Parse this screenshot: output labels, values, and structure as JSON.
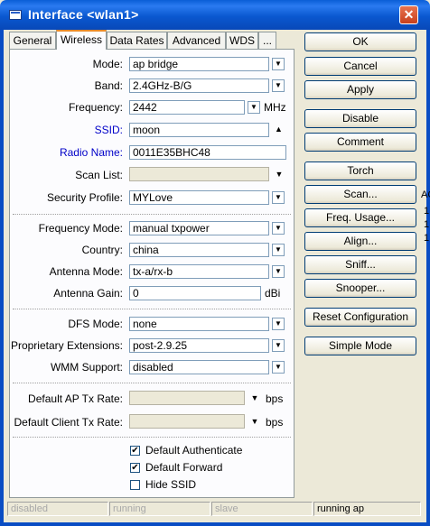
{
  "window": {
    "title": "Interface <wlan1>"
  },
  "tabs": [
    "General",
    "Wireless",
    "Data Rates",
    "Advanced",
    "WDS",
    "..."
  ],
  "form": {
    "mode": {
      "label": "Mode:",
      "value": "ap bridge"
    },
    "band": {
      "label": "Band:",
      "value": "2.4GHz-B/G"
    },
    "frequency": {
      "label": "Frequency:",
      "value": "2442",
      "unit": "MHz"
    },
    "ssid": {
      "label": "SSID:",
      "value": "moon"
    },
    "radio_name": {
      "label": "Radio Name:",
      "value": "0011E35BHC48"
    },
    "scan_list": {
      "label": "Scan List:",
      "value": ""
    },
    "security_profile": {
      "label": "Security Profile:",
      "value": "MYLove"
    },
    "frequency_mode": {
      "label": "Frequency Mode:",
      "value": "manual txpower"
    },
    "country": {
      "label": "Country:",
      "value": "china"
    },
    "antenna_mode": {
      "label": "Antenna Mode:",
      "value": "tx-a/rx-b"
    },
    "antenna_gain": {
      "label": "Antenna Gain:",
      "value": "0",
      "unit": "dBi"
    },
    "dfs_mode": {
      "label": "DFS Mode:",
      "value": "none"
    },
    "proprietary_extensions": {
      "label": "Proprietary Extensions:",
      "value": "post-2.9.25"
    },
    "wmm_support": {
      "label": "WMM Support:",
      "value": "disabled"
    },
    "default_ap_tx_rate": {
      "label": "Default AP Tx Rate:",
      "value": "",
      "unit": "bps"
    },
    "default_client_tx_rate": {
      "label": "Default Client Tx Rate:",
      "value": "",
      "unit": "bps"
    },
    "checkboxes": [
      {
        "label": "Default Authenticate",
        "checked": true
      },
      {
        "label": "Default Forward",
        "checked": true
      },
      {
        "label": "Hide SSID",
        "checked": false
      }
    ]
  },
  "buttons": [
    "OK",
    "Cancel",
    "Apply",
    "Disable",
    "Comment",
    "Torch",
    "Scan...",
    "Freq. Usage...",
    "Align...",
    "Sniff...",
    "Snooper...",
    "Reset Configuration",
    "Simple Mode"
  ],
  "status_bar": [
    "disabled",
    "running",
    "slave",
    "running ap"
  ],
  "background_peek": [
    "AC",
    "1",
    "1",
    "1"
  ],
  "colors": {
    "title_bar": "#0a58d0",
    "accent_tab": "#e68b2c",
    "link_label": "#0000c8"
  }
}
